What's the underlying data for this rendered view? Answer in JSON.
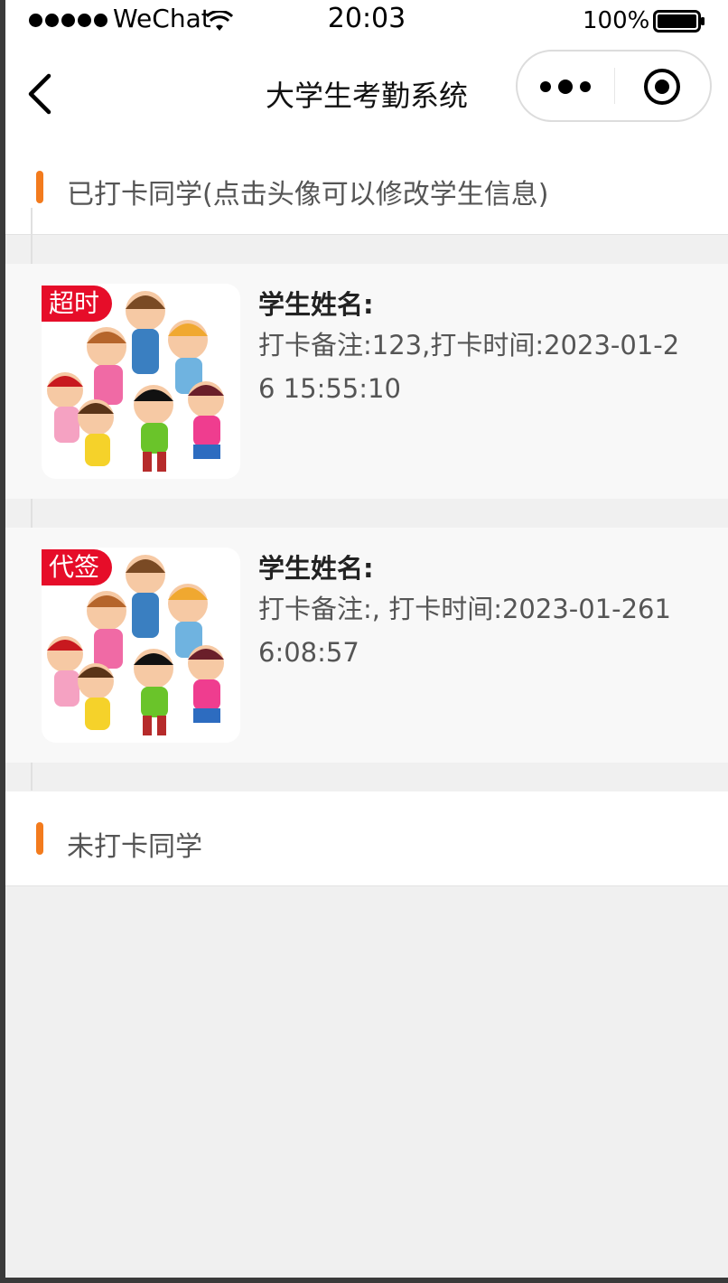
{
  "status_bar": {
    "carrier": "WeChat",
    "time": "20:03",
    "battery": "100%"
  },
  "nav": {
    "title": "大学生考勤系统",
    "back_icon": "chevron-left-icon",
    "more_icon": "more-dots-icon",
    "close_icon": "target-circle-icon"
  },
  "checked_in": {
    "title": "已打卡同学(点击头像可以修改学生信息)",
    "accent": "#f37b1d",
    "students": [
      {
        "tag": "超时",
        "name_label": "学生姓名:",
        "info": "打卡备注:123,打卡时间:2023-01-26 15:55:10"
      },
      {
        "tag": "代签",
        "name_label": "学生姓名:",
        "info": "打卡备注:, 打卡时间:2023-01-2616:08:57"
      }
    ]
  },
  "not_checked_in": {
    "title": "未打卡同学"
  },
  "colors": {
    "tag_red": "#e60d29",
    "page_bg": "#f0f0f0"
  }
}
